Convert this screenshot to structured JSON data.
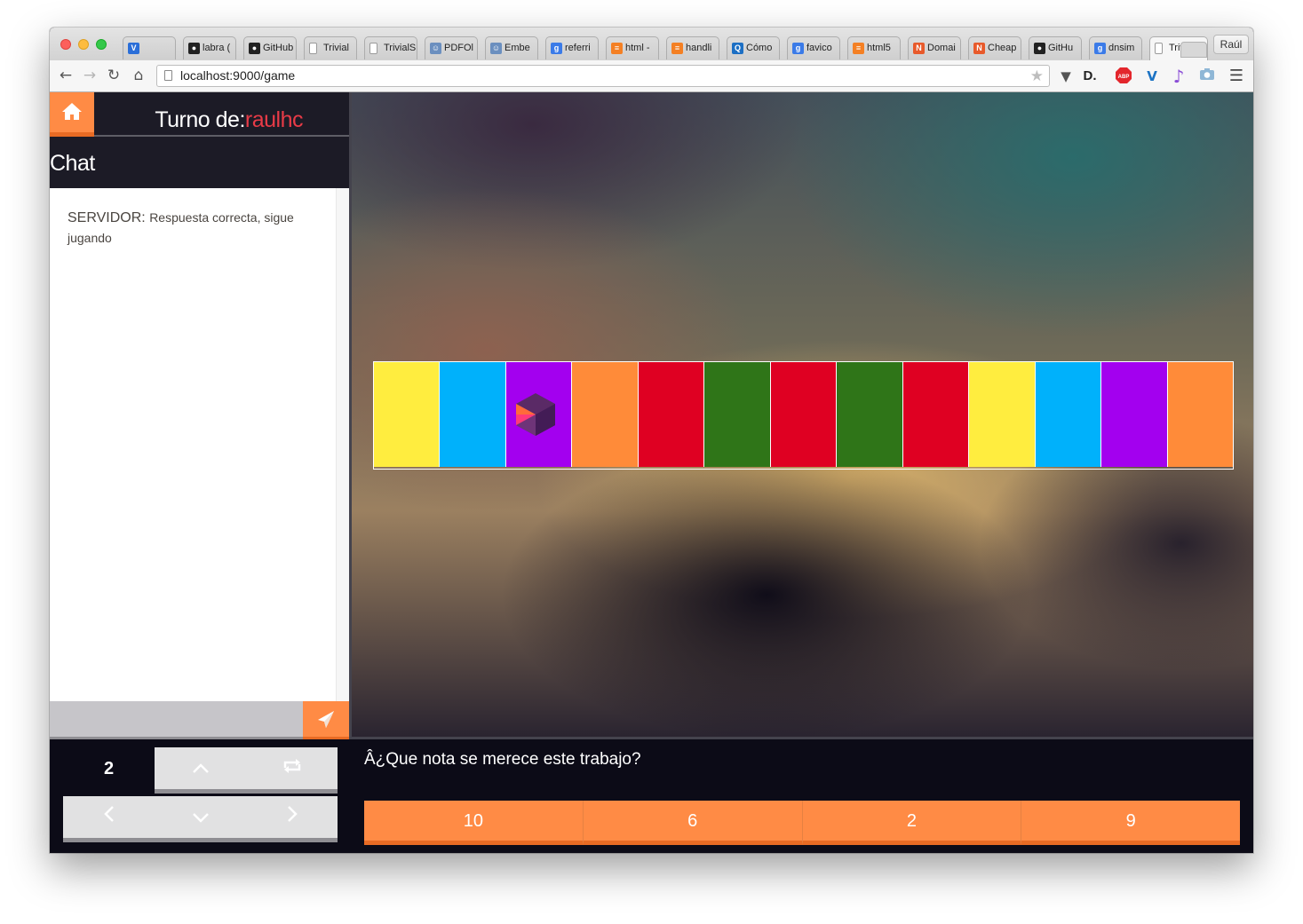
{
  "browser": {
    "profile_name": "Raúl",
    "tabs": [
      {
        "title": "",
        "favicon": "vivaldi-v-icon",
        "color": "#2a6ed8"
      },
      {
        "title": "labra (",
        "favicon": "github-icon",
        "color": "#222222"
      },
      {
        "title": "GitHub",
        "favicon": "github-icon",
        "color": "#222222"
      },
      {
        "title": "Trivial",
        "favicon": "page-icon",
        "color": "#9a9a9a"
      },
      {
        "title": "TrivialS",
        "favicon": "page-icon",
        "color": "#9a9a9a"
      },
      {
        "title": "PDFOl",
        "favicon": "person-icon",
        "color": "#6b8fbf"
      },
      {
        "title": "Embe",
        "favicon": "person-icon",
        "color": "#6b8fbf"
      },
      {
        "title": "referri",
        "favicon": "google-icon",
        "color": "#3b7be8"
      },
      {
        "title": "html -",
        "favicon": "stackoverflow-icon",
        "color": "#f48024"
      },
      {
        "title": "handli",
        "favicon": "stackoverflow-icon",
        "color": "#f48024"
      },
      {
        "title": "Cómo",
        "favicon": "search-q-icon",
        "color": "#1c6fc4"
      },
      {
        "title": "favico",
        "favicon": "google-icon",
        "color": "#3b7be8"
      },
      {
        "title": "html5",
        "favicon": "stackoverflow-icon",
        "color": "#f48024"
      },
      {
        "title": "Domai",
        "favicon": "namecheap-icon",
        "color": "#e85a2b"
      },
      {
        "title": "Cheap",
        "favicon": "namecheap-icon",
        "color": "#e85a2b"
      },
      {
        "title": "GitHu",
        "favicon": "github-icon",
        "color": "#222222"
      },
      {
        "title": "dnsim",
        "favicon": "google-icon",
        "color": "#3b7be8"
      },
      {
        "title": "Triv",
        "favicon": "page-icon",
        "color": "#9a9a9a",
        "active": true
      }
    ],
    "url_host": "localhost",
    "url_path": ":9000/game"
  },
  "sidebar": {
    "turn_label": "Turno de:",
    "turn_player": "raulhc",
    "chat_title": "Chat",
    "messages": [
      {
        "sender": "SERVIDOR:",
        "text": "Respuesta correcta, sigue jugando"
      }
    ],
    "chat_input_value": ""
  },
  "board": {
    "cells": [
      "#ffed3f",
      "#00b1fb",
      "#a300ef",
      "#ff8b39",
      "#df0022",
      "#2f7518",
      "#df0022",
      "#2f7518",
      "#df0022",
      "#ffed3f",
      "#00b1fb",
      "#a300ef",
      "#ff8b39"
    ],
    "token_cell": 3,
    "token_icon": "player-hexagon-icon"
  },
  "controls": {
    "dice_value": "2"
  },
  "question": {
    "text": "Â¿Que nota se merece este trabajo?",
    "answers": [
      "10",
      "6",
      "2",
      "9"
    ]
  },
  "colors": {
    "accent": "#ff8b45",
    "accent_dark": "#e86b24",
    "player": "#e83b47",
    "dark_bg": "#0c0b17"
  }
}
